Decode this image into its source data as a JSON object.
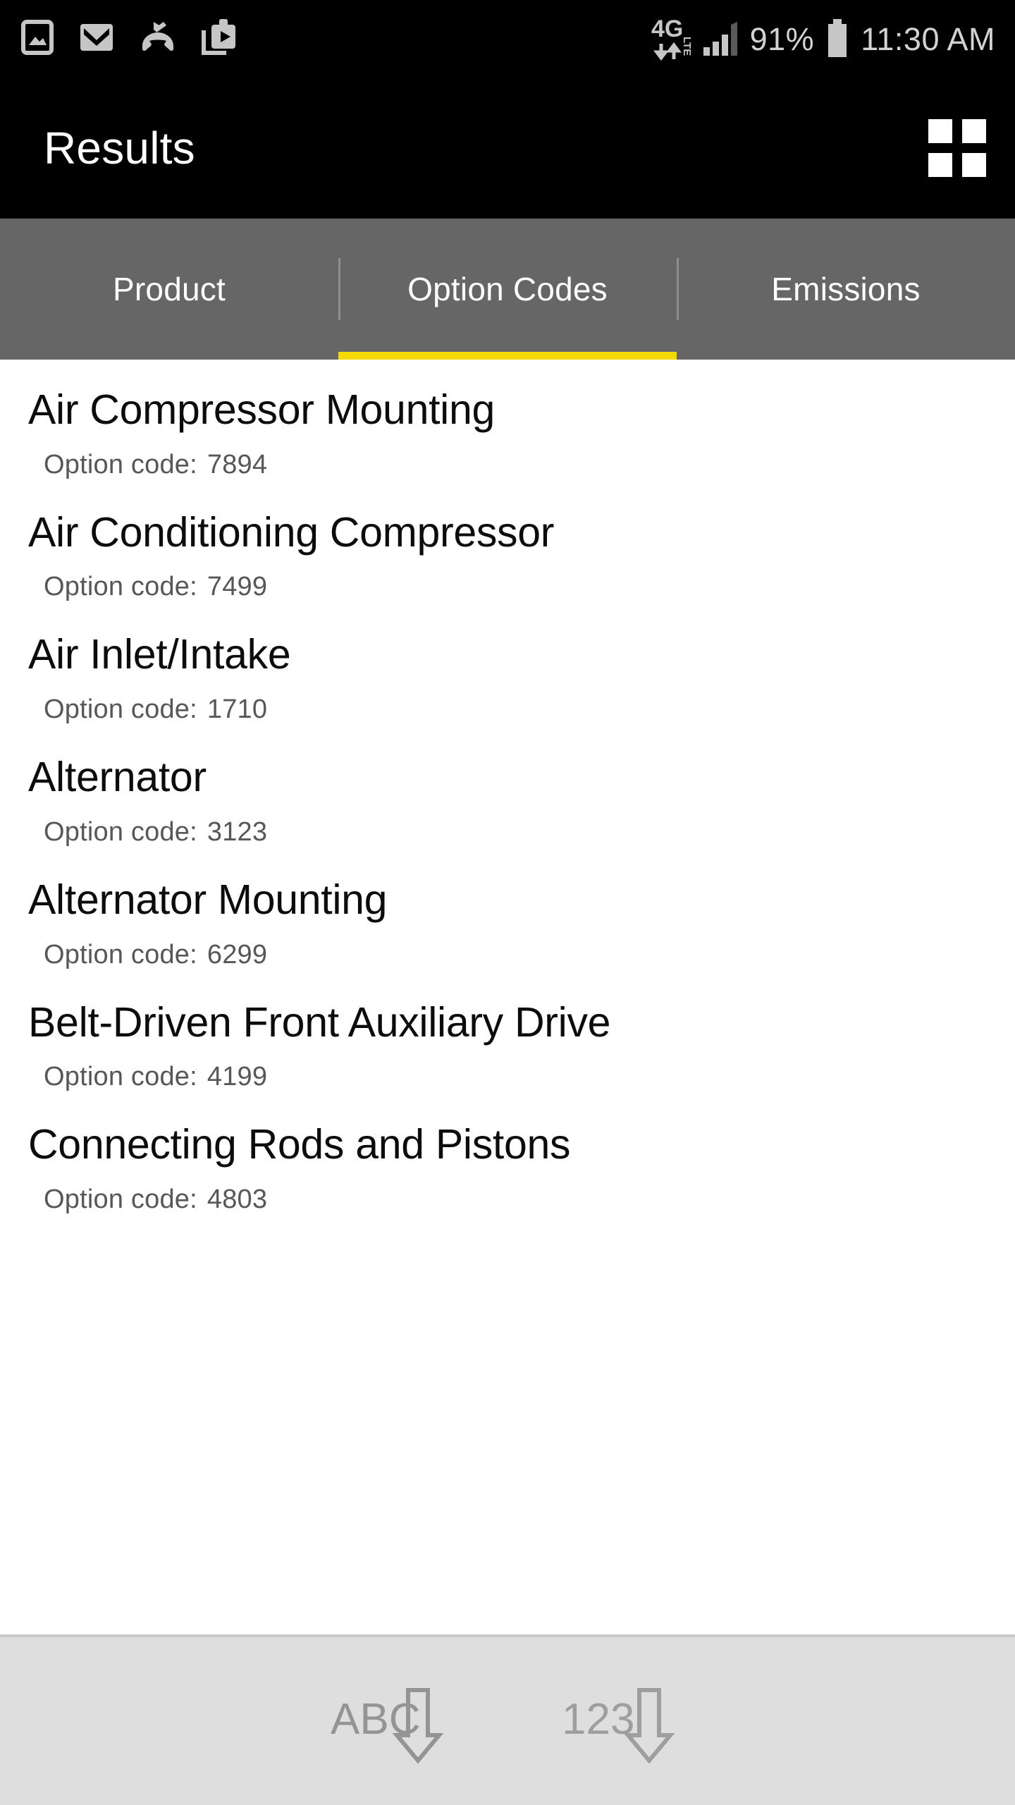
{
  "status_bar": {
    "left_icons": [
      {
        "name": "screenshot-icon",
        "label": "Screenshot"
      },
      {
        "name": "gmail-icon",
        "label": "Gmail"
      },
      {
        "name": "missed-call-icon",
        "label": "Missed call"
      },
      {
        "name": "play-store-icon",
        "label": "Play Store"
      }
    ],
    "network_type": "4G",
    "network_suffix": "LTE",
    "signal_icon": "signal-bars-icon",
    "battery_percent": "91%",
    "battery_icon": "battery-icon",
    "time": "11:30 AM"
  },
  "header": {
    "title": "Results",
    "grid_button_name": "grid-view-button"
  },
  "tabs": [
    {
      "label": "Product",
      "active": false
    },
    {
      "label": "Option Codes",
      "active": true
    },
    {
      "label": "Emissions",
      "active": false
    }
  ],
  "list": {
    "code_label": "Option code:",
    "items": [
      {
        "title": "Air Compressor Mounting",
        "code": "7894"
      },
      {
        "title": "Air Conditioning Compressor",
        "code": "7499"
      },
      {
        "title": "Air Inlet/Intake",
        "code": "1710"
      },
      {
        "title": "Alternator",
        "code": "3123"
      },
      {
        "title": "Alternator Mounting",
        "code": "6299"
      },
      {
        "title": "Belt-Driven Front Auxiliary Drive",
        "code": "4199"
      },
      {
        "title": "Connecting Rods and Pistons",
        "code": "4803"
      }
    ]
  },
  "sort_bar": {
    "buttons": [
      {
        "name": "sort-alphabetical-button",
        "label": "ABC",
        "direction": "down"
      },
      {
        "name": "sort-numeric-button",
        "label": "123",
        "direction": "down"
      }
    ]
  },
  "colors": {
    "accent_yellow": "#f5d900",
    "tab_bar_gray": "#666666",
    "bar_black": "#000000",
    "sort_bar_gray": "#dedede"
  }
}
